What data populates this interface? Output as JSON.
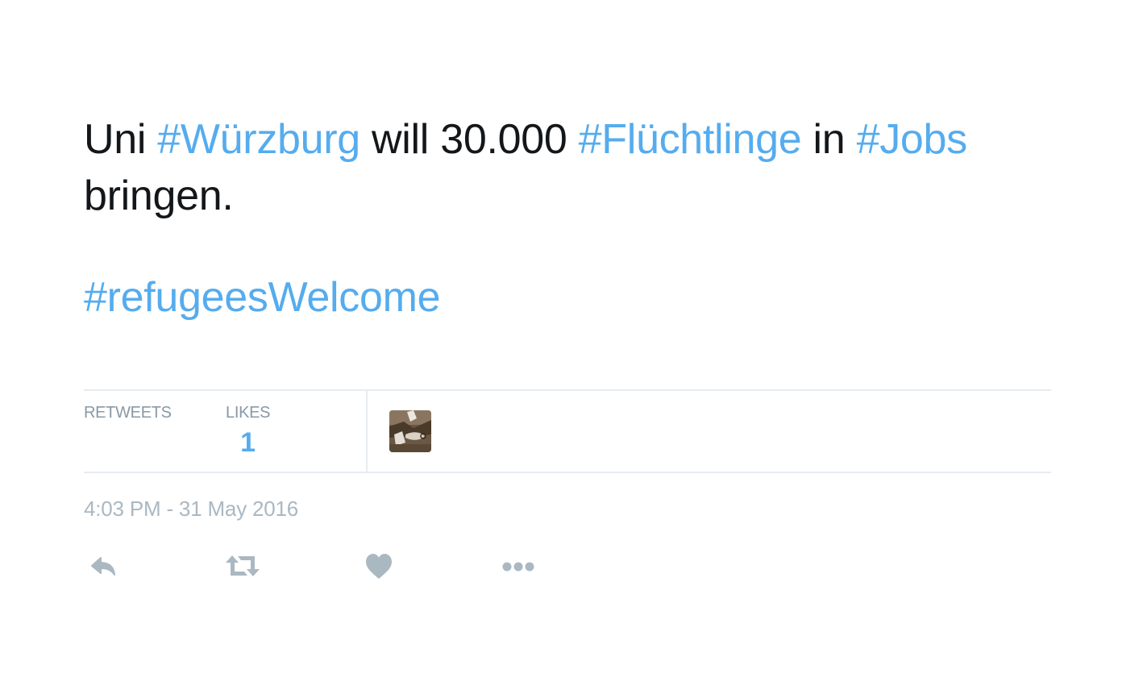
{
  "tweet": {
    "segments": [
      {
        "text": "Uni ",
        "type": "text"
      },
      {
        "text": "#Würzburg",
        "type": "hashtag"
      },
      {
        "text": " will 30.000 ",
        "type": "text"
      },
      {
        "text": "#Flüchtlinge",
        "type": "hashtag"
      },
      {
        "text": " in ",
        "type": "text"
      },
      {
        "text": "#Jobs",
        "type": "hashtag"
      }
    ],
    "line2": "bringen.",
    "tag_line": "#refugeesWelcome"
  },
  "stats": {
    "retweets_label": "RETWEETS",
    "likes_label": "LIKES",
    "likes_count": "1"
  },
  "timestamp": "4:03 PM - 31 May 2016",
  "actions": {
    "reply_icon": "reply-icon",
    "retweet_icon": "retweet-icon",
    "like_icon": "heart-icon",
    "more_icon": "more-dots-icon"
  },
  "colors": {
    "hashtag": "#55acee",
    "text": "#14171a",
    "muted": "#aab8c2",
    "label": "#8899a6",
    "icon": "#aab8c2",
    "divider": "#e6ecf0"
  }
}
